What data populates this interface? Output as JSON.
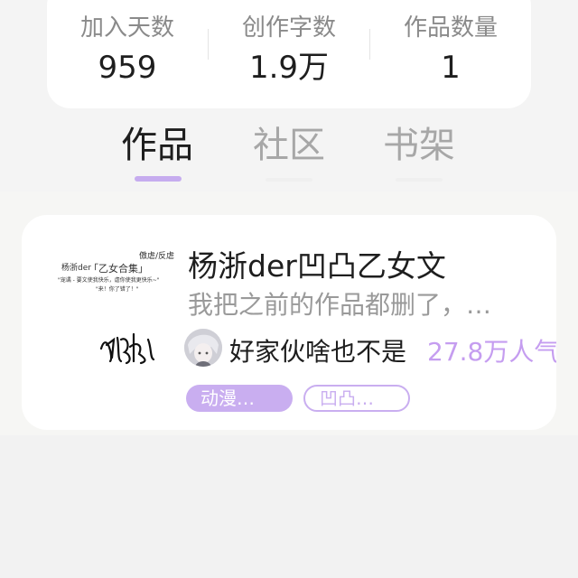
{
  "stats": [
    {
      "label": "加入天数",
      "value": "959"
    },
    {
      "label": "创作字数",
      "value": "1.9万"
    },
    {
      "label": "作品数量",
      "value": "1"
    }
  ],
  "tabs": [
    {
      "label": "作品",
      "active": true
    },
    {
      "label": "社区",
      "active": false
    },
    {
      "label": "书架",
      "active": false
    }
  ],
  "work": {
    "cover_text": {
      "top_right": "傲虐/反虐",
      "collection": "「乙女合集」",
      "author": "杨浙der",
      "blurb_line1": "\"宠谲 - 要文使我快乐，虐你使我更快乐~\"",
      "blurb_line2": "\"来！你了错了！\""
    },
    "title": "杨浙der凹凸乙女文",
    "description": "我把之前的作品都删了，…",
    "author_name": "好家伙啥也不是",
    "popularity": "27.8万人气",
    "tags": [
      "动漫…",
      "凹凸…"
    ]
  },
  "colors": {
    "accent": "#c6acef",
    "popularity": "#c59df0",
    "background": "#f2f2f2"
  }
}
